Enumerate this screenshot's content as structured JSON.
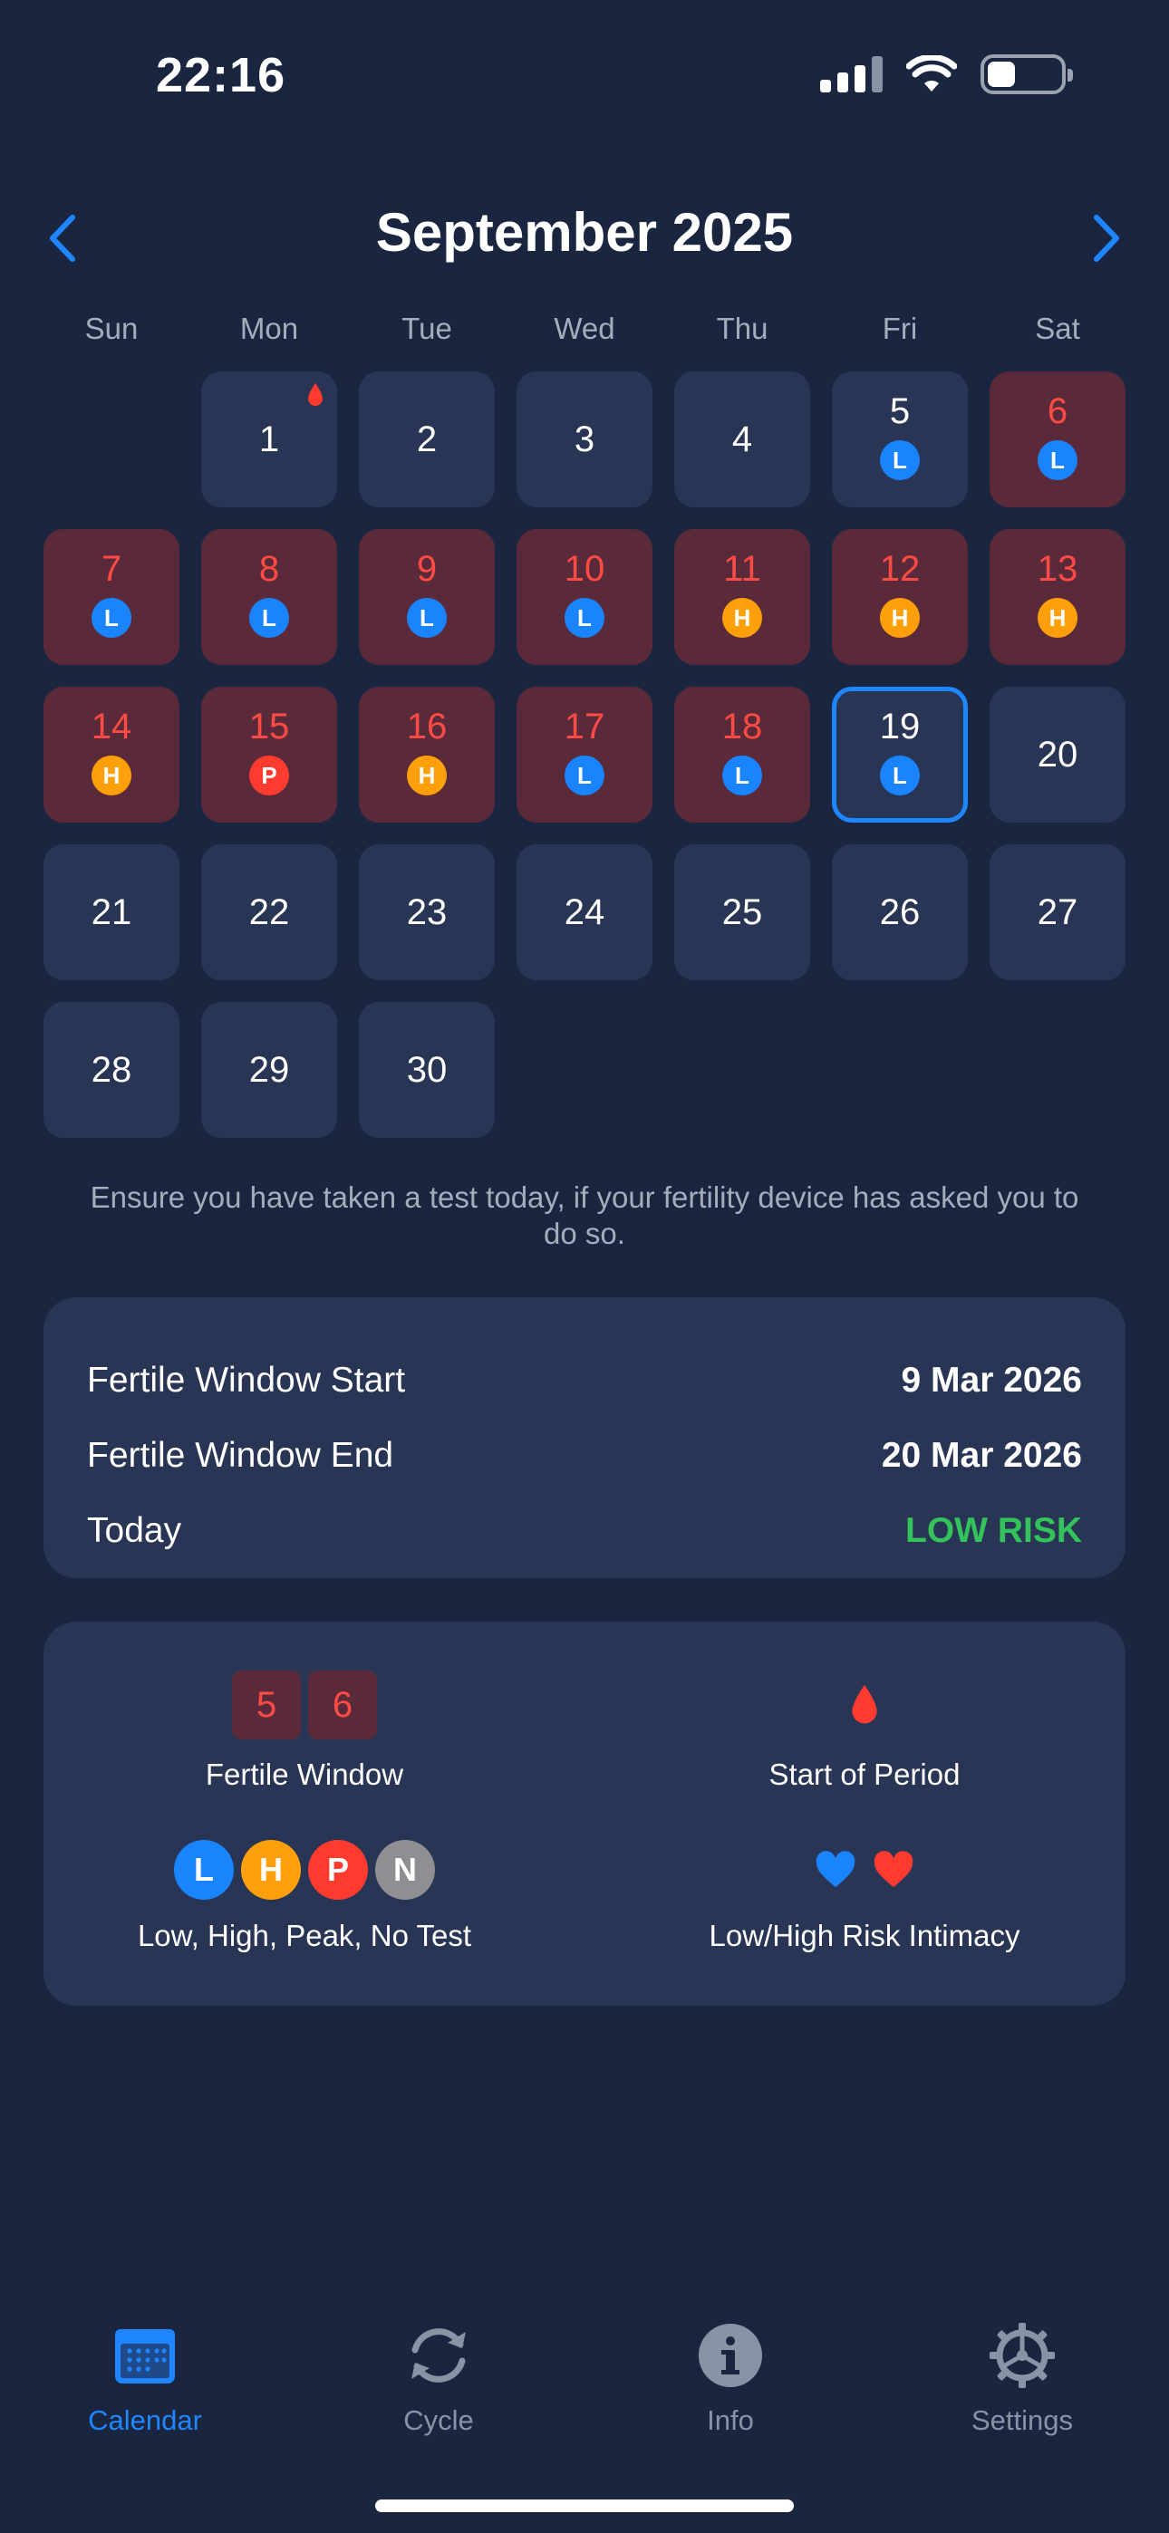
{
  "status_bar": {
    "time": "22:16",
    "battery_level": 0.38
  },
  "header": {
    "month_title": "September 2025",
    "prev_icon": "chevron-left-icon",
    "next_icon": "chevron-right-icon"
  },
  "weekdays": [
    "Sun",
    "Mon",
    "Tue",
    "Wed",
    "Thu",
    "Fri",
    "Sat"
  ],
  "calendar": {
    "leading_blanks": 1,
    "days": [
      {
        "n": "1",
        "fertile": false,
        "badge": null,
        "period_start": true
      },
      {
        "n": "2",
        "fertile": false,
        "badge": null
      },
      {
        "n": "3",
        "fertile": false,
        "badge": null
      },
      {
        "n": "4",
        "fertile": false,
        "badge": null
      },
      {
        "n": "5",
        "fertile": false,
        "badge": "L"
      },
      {
        "n": "6",
        "fertile": true,
        "badge": "L"
      },
      {
        "n": "7",
        "fertile": true,
        "badge": "L"
      },
      {
        "n": "8",
        "fertile": true,
        "badge": "L"
      },
      {
        "n": "9",
        "fertile": true,
        "badge": "L"
      },
      {
        "n": "10",
        "fertile": true,
        "badge": "L"
      },
      {
        "n": "11",
        "fertile": true,
        "badge": "H"
      },
      {
        "n": "12",
        "fertile": true,
        "badge": "H"
      },
      {
        "n": "13",
        "fertile": true,
        "badge": "H"
      },
      {
        "n": "14",
        "fertile": true,
        "badge": "H"
      },
      {
        "n": "15",
        "fertile": true,
        "badge": "P"
      },
      {
        "n": "16",
        "fertile": true,
        "badge": "H"
      },
      {
        "n": "17",
        "fertile": true,
        "badge": "L"
      },
      {
        "n": "18",
        "fertile": true,
        "badge": "L"
      },
      {
        "n": "19",
        "fertile": false,
        "badge": "L",
        "today": true
      },
      {
        "n": "20",
        "fertile": false,
        "badge": null
      },
      {
        "n": "21",
        "fertile": false,
        "badge": null
      },
      {
        "n": "22",
        "fertile": false,
        "badge": null
      },
      {
        "n": "23",
        "fertile": false,
        "badge": null
      },
      {
        "n": "24",
        "fertile": false,
        "badge": null
      },
      {
        "n": "25",
        "fertile": false,
        "badge": null
      },
      {
        "n": "26",
        "fertile": false,
        "badge": null
      },
      {
        "n": "27",
        "fertile": false,
        "badge": null
      },
      {
        "n": "28",
        "fertile": false,
        "badge": null
      },
      {
        "n": "29",
        "fertile": false,
        "badge": null
      },
      {
        "n": "30",
        "fertile": false,
        "badge": null
      }
    ]
  },
  "note": "Ensure you have taken a test today, if your fertility device has asked you to do so.",
  "info": {
    "start_label": "Fertile Window Start",
    "start_value": "9 Mar 2026",
    "end_label": "Fertile Window End",
    "end_value": "20 Mar 2026",
    "today_label": "Today",
    "today_value": "LOW RISK"
  },
  "legend": {
    "fertile_days": [
      "5",
      "6"
    ],
    "fertile_label": "Fertile Window",
    "period_label": "Start of Period",
    "tests": [
      "L",
      "H",
      "P",
      "N"
    ],
    "tests_label": "Low, High, Peak, No Test",
    "intimacy_label": "Low/High Risk Intimacy"
  },
  "tabs": {
    "calendar": "Calendar",
    "cycle": "Cycle",
    "info": "Info",
    "settings": "Settings"
  },
  "colors": {
    "background": "#1a2540",
    "cell": "#283554",
    "fertile_cell": "#5a2a3a",
    "accent": "#1f86ff",
    "low": "#1a84ff",
    "high": "#ff9f0a",
    "peak": "#ff3b30",
    "no_test": "#8e8e93",
    "low_risk_text": "#33c35a"
  }
}
